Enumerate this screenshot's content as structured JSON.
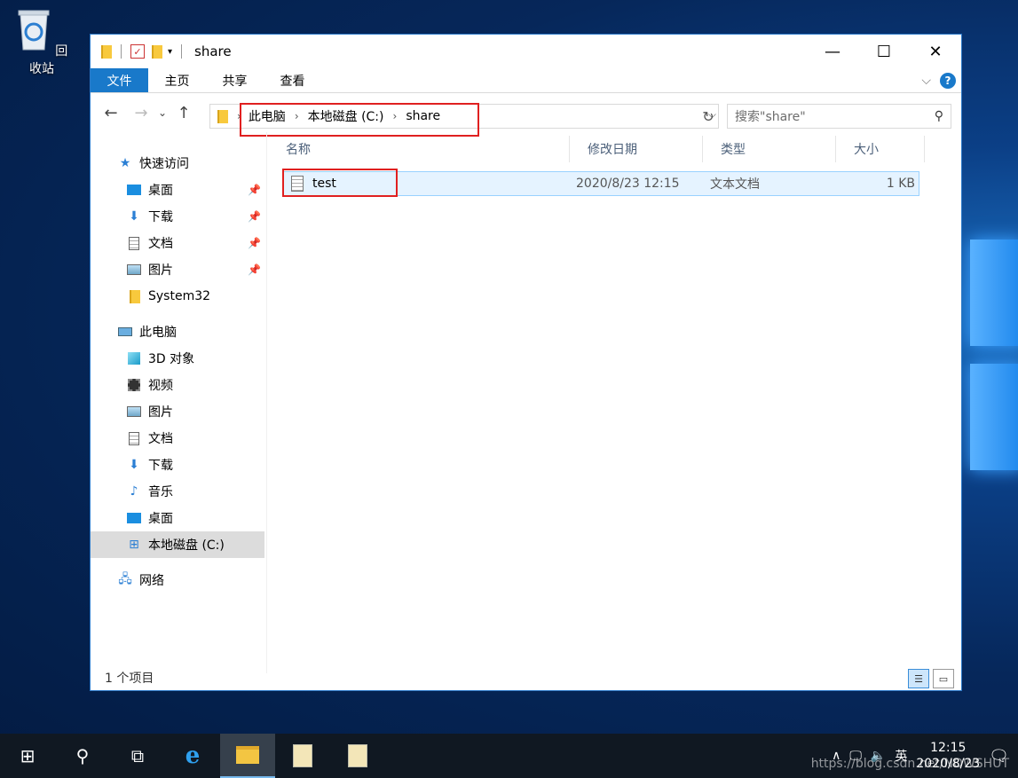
{
  "desktop": {
    "recycle_bin_label": "回收站"
  },
  "window": {
    "title": "share",
    "controls": {
      "minimize": "—",
      "maximize": "☐",
      "close": "✕"
    }
  },
  "ribbon": {
    "tabs": [
      "文件",
      "主页",
      "共享",
      "查看"
    ],
    "collapse": "⌵",
    "help": "?"
  },
  "nav": {
    "back": "←",
    "forward": "→",
    "history": "⌄",
    "up": "↑",
    "breadcrumb": [
      "此电脑",
      "本地磁盘 (C:)",
      "share"
    ],
    "refresh": "↻",
    "search_placeholder": "搜索\"share\""
  },
  "sidebar": {
    "quick_access": "快速访问",
    "pinned": [
      {
        "label": "桌面",
        "icon": "desktop-icon"
      },
      {
        "label": "下载",
        "icon": "download-icon"
      },
      {
        "label": "文档",
        "icon": "document-icon"
      },
      {
        "label": "图片",
        "icon": "picture-icon"
      },
      {
        "label": "System32",
        "icon": "folder-icon"
      }
    ],
    "this_pc": "此电脑",
    "pc_items": [
      {
        "label": "3D 对象",
        "icon": "cube-icon"
      },
      {
        "label": "视频",
        "icon": "video-icon"
      },
      {
        "label": "图片",
        "icon": "picture-icon"
      },
      {
        "label": "文档",
        "icon": "document-icon"
      },
      {
        "label": "下载",
        "icon": "download-icon"
      },
      {
        "label": "音乐",
        "icon": "music-icon"
      },
      {
        "label": "桌面",
        "icon": "desktop-icon"
      },
      {
        "label": "本地磁盘 (C:)",
        "icon": "drive-icon"
      }
    ],
    "network": "网络"
  },
  "columns": [
    "名称",
    "修改日期",
    "类型",
    "大小"
  ],
  "files": [
    {
      "name": "test",
      "modified": "2020/8/23 12:15",
      "type": "文本文档",
      "size": "1 KB"
    }
  ],
  "status": {
    "count": "1 个项目"
  },
  "taskbar": {
    "time": "12:15",
    "date": "2020/8/23",
    "ime": "英",
    "watermark": "https://blog.csdn.net/NOWSHUT"
  }
}
